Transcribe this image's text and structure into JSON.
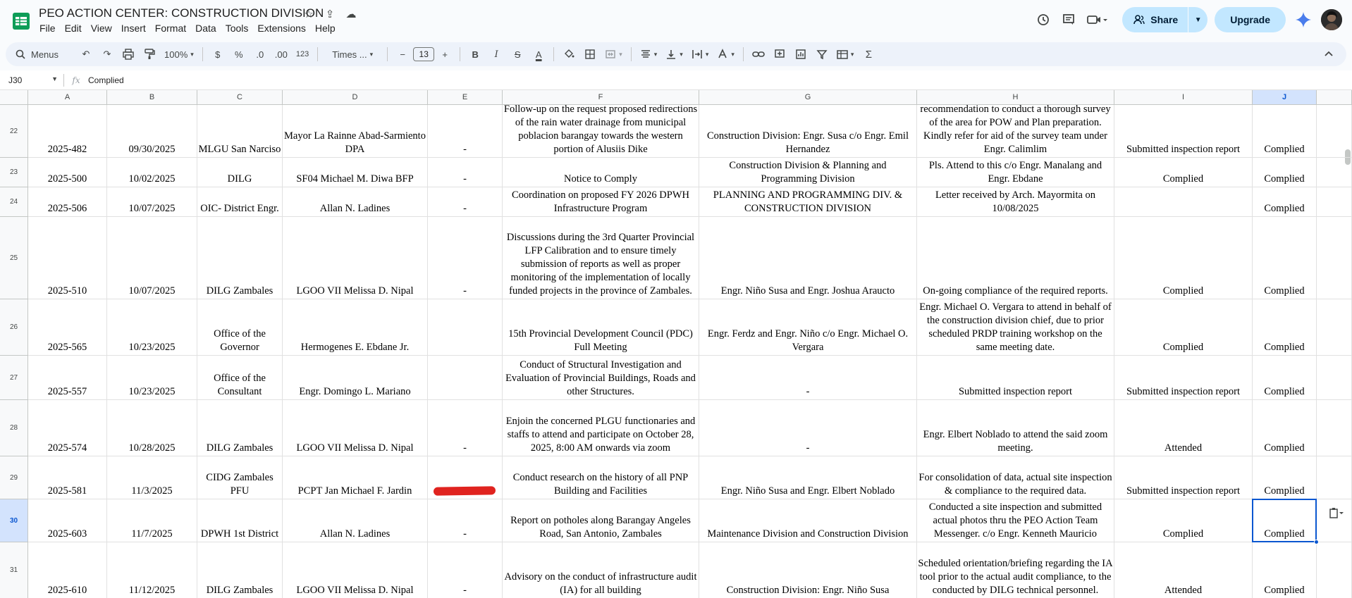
{
  "app": {
    "title": "PEO ACTION CENTER: CONSTRUCTION DIVISION",
    "menus": [
      "File",
      "Edit",
      "View",
      "Insert",
      "Format",
      "Data",
      "Tools",
      "Extensions",
      "Help"
    ],
    "share_label": "Share",
    "upgrade_label": "Upgrade"
  },
  "toolbar": {
    "menus_search": "Menus",
    "zoom": "100%",
    "currency": "$",
    "percent": "%",
    "decrease_decimal": ".0",
    "increase_decimal": ".00",
    "number_format": "123",
    "font": "Times ...",
    "font_size": "13",
    "bold": "B",
    "italic": "I",
    "strike": "S",
    "text_color": "A"
  },
  "formula_bar": {
    "cell_ref": "J30",
    "fx": "fx",
    "value": "Complied"
  },
  "sheet": {
    "columns": [
      "A",
      "B",
      "C",
      "D",
      "E",
      "F",
      "G",
      "H",
      "I",
      "J"
    ],
    "selected_column": "J",
    "selected_row": "30",
    "rows": [
      {
        "num": "22",
        "cells": [
          "2025-482",
          "09/30/2025",
          "MLGU San Narciso",
          "Mayor La Rainne Abad-Sarmiento DPA",
          "-",
          "Follow-up on the request proposed redirections of the rain water drainage from municipal poblacion barangay towards the western portion of Alusiis Dike",
          "Construction Division: Engr. Susa c/o Engr. Emil Hernandez",
          "recommendation to conduct a thorough survey of the area for POW and Plan preparation. Kindly refer for aid of the survey team under Engr. Calimlim",
          "Submitted inspection report",
          "Complied"
        ]
      },
      {
        "num": "23",
        "cells": [
          "2025-500",
          "10/02/2025",
          "DILG",
          "SF04 Michael M. Diwa BFP",
          "-",
          "Notice to Comply",
          "Construction Division & Planning and Programming Division",
          "Pls. Attend to this c/o Engr. Manalang and Engr. Ebdane",
          "Complied",
          "Complied"
        ]
      },
      {
        "num": "24",
        "cells": [
          "2025-506",
          "10/07/2025",
          "OIC- District Engr.",
          "Allan N. Ladines",
          "-",
          "Coordination on proposed FY 2026 DPWH Infrastructure Program",
          "PLANNING AND PROGRAMMING DIV. & CONSTRUCTION DIVISION",
          "Letter received by Arch. Mayormita on 10/08/2025",
          "",
          "Complied"
        ]
      },
      {
        "num": "25",
        "cells": [
          "2025-510",
          "10/07/2025",
          "DILG Zambales",
          "LGOO VII Melissa D. Nipal",
          "-",
          "Discussions during the 3rd Quarter Provincial LFP Calibration and to ensure timely submission of reports as well as proper monitoring of the implementation of locally funded projects in the province of Zambales.",
          "Engr. Niño Susa and Engr. Joshua Araucto",
          "On-going compliance of the required reports.",
          "Complied",
          "Complied"
        ]
      },
      {
        "num": "26",
        "cells": [
          "2025-565",
          "10/23/2025",
          "Office of the Governor",
          "Hermogenes E. Ebdane Jr.",
          "",
          "15th Provincial Development Council (PDC) Full Meeting",
          "Engr. Ferdz and Engr. Niño c/o Engr. Michael O. Vergara",
          "Engr. Michael O. Vergara to attend in behalf of the construction division chief, due to prior scheduled PRDP training workshop on the same meeting date.",
          "Complied",
          "Complied"
        ]
      },
      {
        "num": "27",
        "cells": [
          "2025-557",
          "10/23/2025",
          "Office of the Consultant",
          "Engr. Domingo L. Mariano",
          "",
          "Conduct of Structural Investigation and Evaluation of Provincial Buildings, Roads and other Structures.",
          "-",
          "Submitted inspection report",
          "Submitted inspection report",
          "Complied"
        ]
      },
      {
        "num": "28",
        "cells": [
          "2025-574",
          "10/28/2025",
          "DILG Zambales",
          "LGOO VII Melissa D. Nipal",
          "-",
          "Enjoin the concerned PLGU functionaries and staffs to attend and participate on October 28, 2025, 8:00 AM onwards via zoom",
          "-",
          "Engr. Elbert Noblado to attend the said zoom meeting.",
          "Attended",
          "Complied"
        ]
      },
      {
        "num": "29",
        "cells": [
          "2025-581",
          "11/3/2025",
          "CIDG Zambales PFU",
          "PCPT Jan Michael F. Jardin",
          "",
          "Conduct research on the history of all PNP Building and Facilities",
          "Engr. Niño Susa and Engr. Elbert Noblado",
          "For consolidation of data, actual site inspection & compliance to the required data.",
          "Submitted inspection report",
          "Complied"
        ]
      },
      {
        "num": "30",
        "cells": [
          "2025-603",
          "11/7/2025",
          "DPWH 1st District",
          "Allan N. Ladines",
          "-",
          "Report on potholes along Barangay Angeles Road, San Antonio, Zambales",
          "Maintenance Division and Construction Division",
          "Conducted a site inspection and submitted actual photos thru the PEO Action Team Messenger. c/o Engr. Kenneth Mauricio",
          "Complied",
          "Complied"
        ]
      },
      {
        "num": "31",
        "cells": [
          "2025-610",
          "11/12/2025",
          "DILG Zambales",
          "LGOO VII Melissa D. Nipal",
          "-",
          "Advisory on the conduct of infrastructure audit (IA) for all building",
          "Construction Division: Engr. Niño Susa",
          "Scheduled orientation/briefing regarding the IA tool prior to the actual audit compliance, to the conducted by DILG technical personnel.",
          "Attended",
          "Complied"
        ]
      }
    ]
  }
}
